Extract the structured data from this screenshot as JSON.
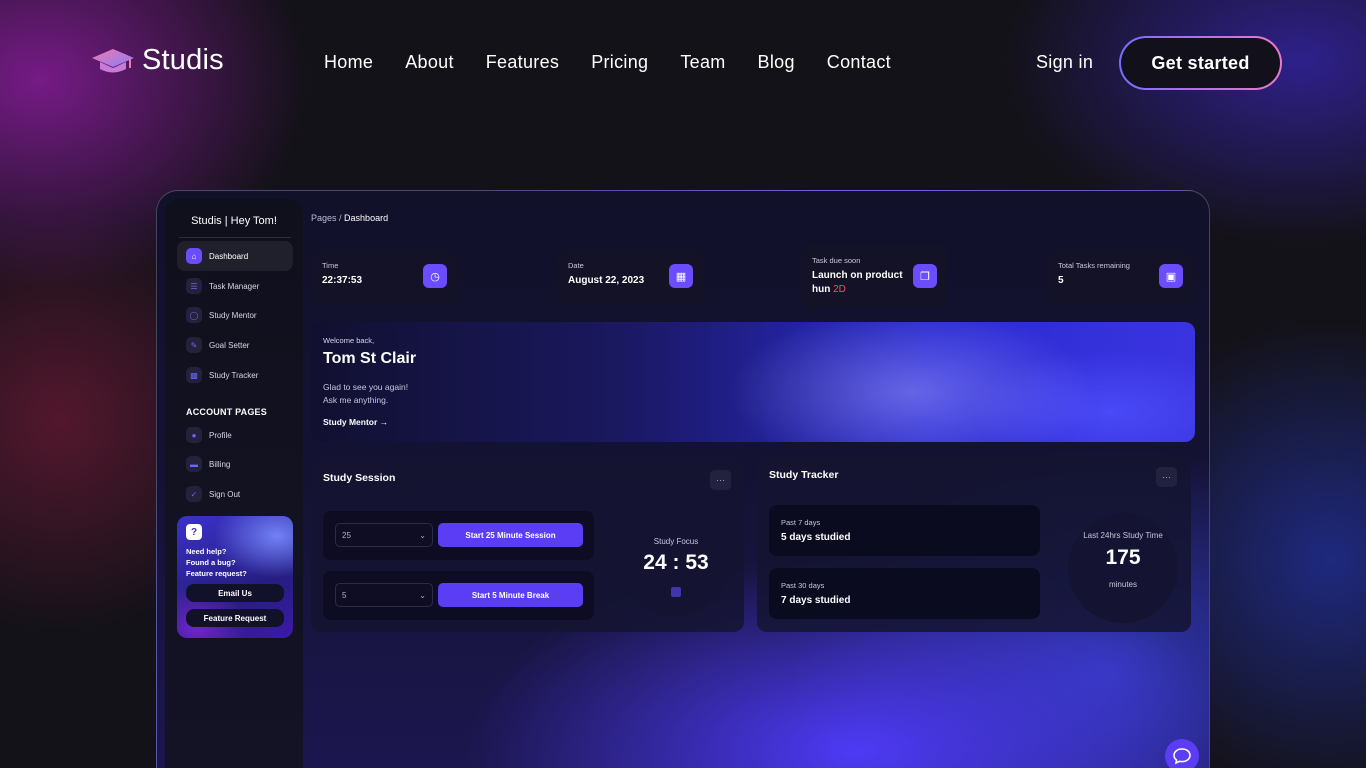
{
  "brand": {
    "name": "Studis",
    "accent": "#6b4dff",
    "cta_gradient": [
      "#7b6cff",
      "#e97ac9"
    ]
  },
  "nav": {
    "links": [
      "Home",
      "About",
      "Features",
      "Pricing",
      "Team",
      "Blog",
      "Contact"
    ],
    "signin": "Sign in",
    "cta": "Get started"
  },
  "dashboard": {
    "sidebar": {
      "title": "Studis | Hey Tom!",
      "items": [
        {
          "label": "Dashboard",
          "icon": "home-icon",
          "active": true
        },
        {
          "label": "Task Manager",
          "icon": "list-icon"
        },
        {
          "label": "Study Mentor",
          "icon": "chat-icon"
        },
        {
          "label": "Goal Setter",
          "icon": "pencil-icon"
        },
        {
          "label": "Study Tracker",
          "icon": "chart-icon"
        }
      ],
      "section_label": "ACCOUNT PAGES",
      "account_items": [
        {
          "label": "Profile",
          "icon": "person-icon"
        },
        {
          "label": "Billing",
          "icon": "card-icon"
        },
        {
          "label": "Sign Out",
          "icon": "check-icon"
        }
      ],
      "help": {
        "text": [
          "Need help?",
          "Found a bug?",
          "Feature request?"
        ],
        "email_button": "Email Us",
        "feature_button": "Feature Request"
      }
    },
    "breadcrumb": {
      "parent": "Pages",
      "separator": " / ",
      "current": "Dashboard"
    },
    "stats": [
      {
        "label": "Time",
        "value": "22:37:53",
        "icon": "clock-icon"
      },
      {
        "label": "Date",
        "value": "August 22, 2023",
        "icon": "calendar-icon"
      },
      {
        "label": "Task due soon",
        "value": "Launch on product hun",
        "due": "2D",
        "icon": "copy-icon"
      },
      {
        "label": "Total Tasks remaining",
        "value": "5",
        "icon": "cart-icon"
      }
    ],
    "welcome": {
      "greeting": "Welcome back,",
      "name": "Tom St Clair",
      "line1": "Glad to see you again!",
      "line2": "Ask me anything.",
      "link": "Study Mentor →"
    },
    "study_session": {
      "title": "Study Session",
      "menu": "···",
      "rows": [
        {
          "select_value": "25",
          "button": "Start 25 Minute Session"
        },
        {
          "select_value": "5",
          "button": "Start 5 Minute Break"
        }
      ],
      "focus_label": "Study Focus",
      "timer": "24 : 53"
    },
    "study_tracker": {
      "title": "Study Tracker",
      "menu": "···",
      "rows": [
        {
          "label": "Past 7 days",
          "value": "5 days studied"
        },
        {
          "label": "Past 30 days",
          "value": "7 days studied"
        }
      ],
      "last24_label": "Last 24hrs Study Time",
      "last24_value": "175",
      "last24_unit": "minutes"
    }
  }
}
